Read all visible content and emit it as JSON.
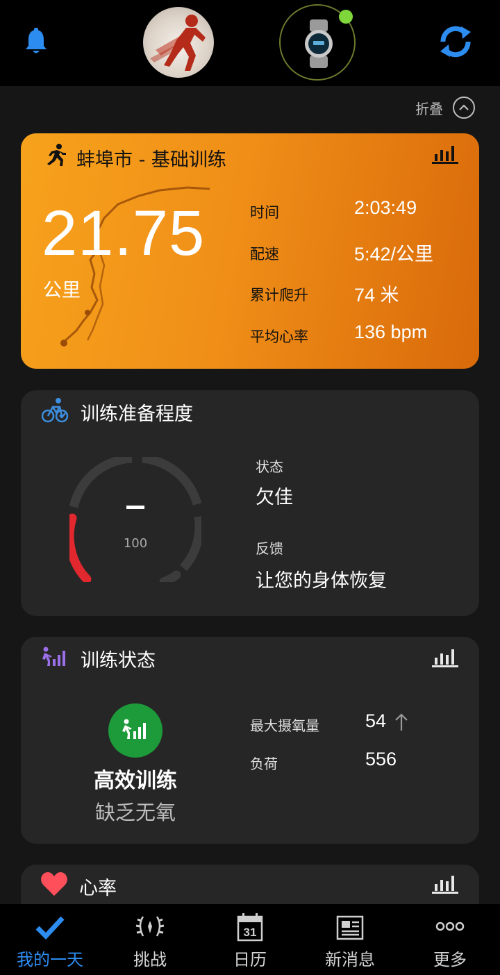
{
  "colors": {
    "accent_blue": "#2d8cf0",
    "activity_orange": "#f08f18",
    "good_green": "#1d9a39",
    "gauge_red": "#e0282e",
    "watch_connected": "#7fd63a"
  },
  "header": {
    "icons": [
      "bell-icon",
      "profile-avatar",
      "watch-device",
      "sync-icon"
    ]
  },
  "collapse": {
    "label": "折叠"
  },
  "activity": {
    "title": "蚌埠市 - 基础训练",
    "distance": "21.75",
    "distance_unit": "公里",
    "stats": [
      {
        "label": "时间",
        "value": "2:03:49"
      },
      {
        "label": "配速",
        "value": "5:42/公里"
      },
      {
        "label": "累计爬升",
        "value": "74 米"
      },
      {
        "label": "平均心率",
        "value": "136 bpm"
      }
    ]
  },
  "readiness": {
    "title": "训练准备程度",
    "gauge_value": "–",
    "gauge_scale": "100",
    "status_label": "状态",
    "status_value": "欠佳",
    "feedback_label": "反馈",
    "feedback_value": "让您的身体恢复"
  },
  "training_status": {
    "title": "训练状态",
    "status": "高效训练",
    "sub_status": "缺乏无氧",
    "metrics": [
      {
        "label": "最大摄氧量",
        "value": "54"
      },
      {
        "label": "负荷",
        "value": "556"
      }
    ]
  },
  "heart_rate": {
    "title": "心率"
  },
  "nav": [
    {
      "label": "我的一天",
      "icon": "check-icon",
      "active": true
    },
    {
      "label": "挑战",
      "icon": "laurel-icon",
      "active": false
    },
    {
      "label": "日历",
      "icon": "calendar-icon",
      "calendar_day": "31",
      "active": false
    },
    {
      "label": "新消息",
      "icon": "news-icon",
      "active": false
    },
    {
      "label": "更多",
      "icon": "more-icon",
      "active": false
    }
  ]
}
